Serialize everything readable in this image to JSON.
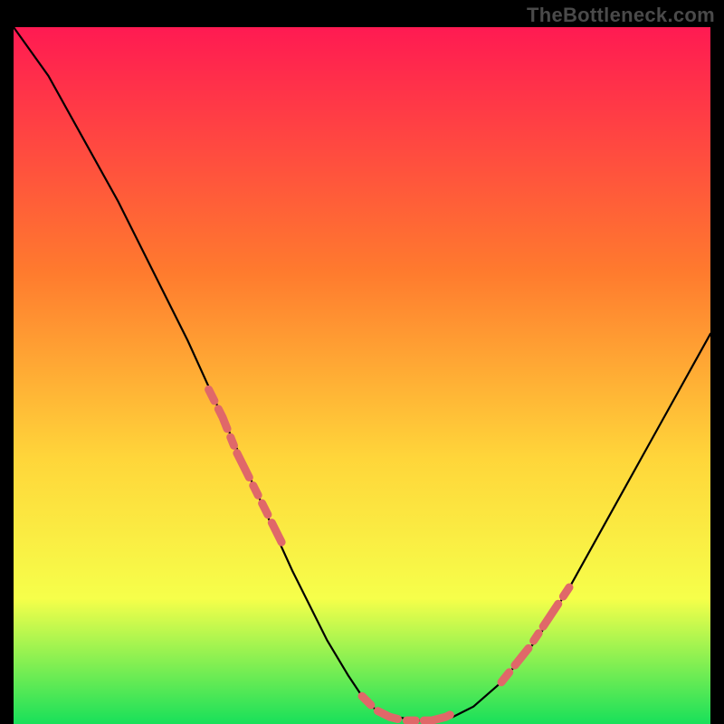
{
  "watermark": "TheBottleneck.com",
  "colors": {
    "frame": "#000000",
    "grad_top": "#ff1a52",
    "grad_mid1": "#ff7a2e",
    "grad_mid2": "#ffd63a",
    "grad_mid3": "#f6ff4a",
    "grad_bottom": "#18e05a",
    "curve": "#000000",
    "highlight": "#e06869"
  },
  "chart_data": {
    "type": "line",
    "title": "",
    "xlabel": "",
    "ylabel": "",
    "xlim": [
      0,
      100
    ],
    "ylim": [
      0,
      100
    ],
    "grid": false,
    "legend": false,
    "annotations": [],
    "series": [
      {
        "name": "bottleneck-curve",
        "x": [
          0,
          5,
          10,
          15,
          20,
          25,
          30,
          35,
          40,
          45,
          48,
          50,
          52,
          55,
          58,
          60,
          63,
          66,
          70,
          75,
          80,
          85,
          90,
          95,
          100
        ],
        "y": [
          100,
          93,
          84,
          75,
          65,
          55,
          44,
          33,
          22,
          12,
          7,
          4,
          2,
          1,
          0.5,
          0.5,
          1,
          2.5,
          6,
          12,
          20,
          29,
          38,
          47,
          56
        ]
      },
      {
        "name": "highlight-left",
        "x": [
          28,
          30,
          32,
          34,
          36,
          38,
          39
        ],
        "y": [
          48,
          44,
          39,
          35,
          31,
          27,
          25
        ]
      },
      {
        "name": "highlight-bottom",
        "x": [
          50,
          52,
          54,
          56,
          58,
          60,
          62,
          63
        ],
        "y": [
          4,
          2,
          1,
          0.5,
          0.5,
          0.5,
          1,
          1.5
        ]
      },
      {
        "name": "highlight-right",
        "x": [
          70,
          72,
          74,
          76,
          78,
          80
        ],
        "y": [
          6,
          8.5,
          11,
          14,
          17,
          20
        ]
      }
    ]
  }
}
